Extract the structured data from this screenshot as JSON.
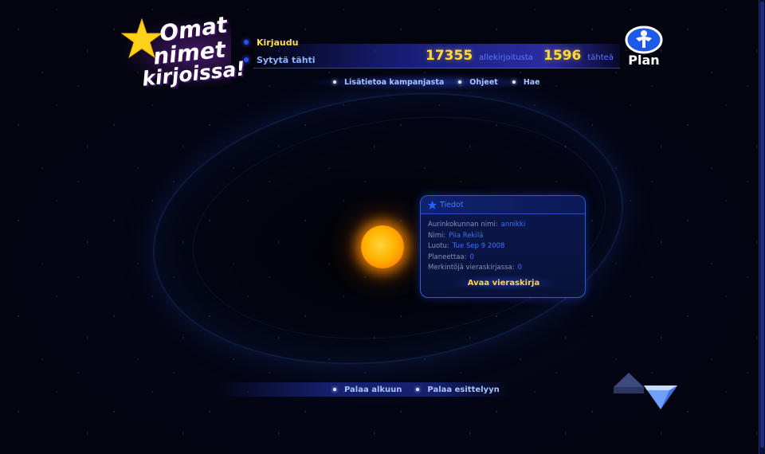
{
  "logo": {
    "line1": "Omat",
    "line2": "nimet",
    "line3": "kirjoissa!"
  },
  "menu": {
    "login": "Kirjaudu",
    "light_star": "Sytytä tähti"
  },
  "counters": {
    "signatures": "17355",
    "signatures_label": "allekirjoitusta",
    "stars": "1596",
    "stars_label": "tähteä"
  },
  "brand": {
    "plan": "Plan"
  },
  "subnav": {
    "more_info": "Lisätietoa kampanjasta",
    "instructions": "Ohjeet",
    "search": "Hae"
  },
  "info_panel": {
    "title": "Tiedot",
    "rows": [
      {
        "key": "Aurinkokunnan nimi:",
        "value": "annikki"
      },
      {
        "key": "Nimi:",
        "value": "Piia Rekilä"
      },
      {
        "key": "Luotu:",
        "value": "Tue Sep 9 2008"
      },
      {
        "key": "Planeettaa:",
        "value": "0"
      },
      {
        "key": "Merkintöjä vieraskirjassa:",
        "value": "0"
      }
    ],
    "guestbook_button": "Avaa vieraskirja"
  },
  "bottomnav": {
    "back_to_start": "Palaa alkuun",
    "back_to_intro": "Palaa esittelyyn"
  },
  "colors": {
    "accent_yellow": "#ffd83a",
    "link_blue": "#a6c4ff",
    "value_blue": "#3d72ff",
    "panel_border": "#2e5ae0",
    "sun": "#ffb300"
  },
  "icons": {
    "logo_star": "star-icon",
    "panel_star": "star-icon",
    "plan_logo": "plan-logo-icon",
    "arrow_up": "arrow-up-icon",
    "arrow_down": "arrow-down-icon"
  }
}
